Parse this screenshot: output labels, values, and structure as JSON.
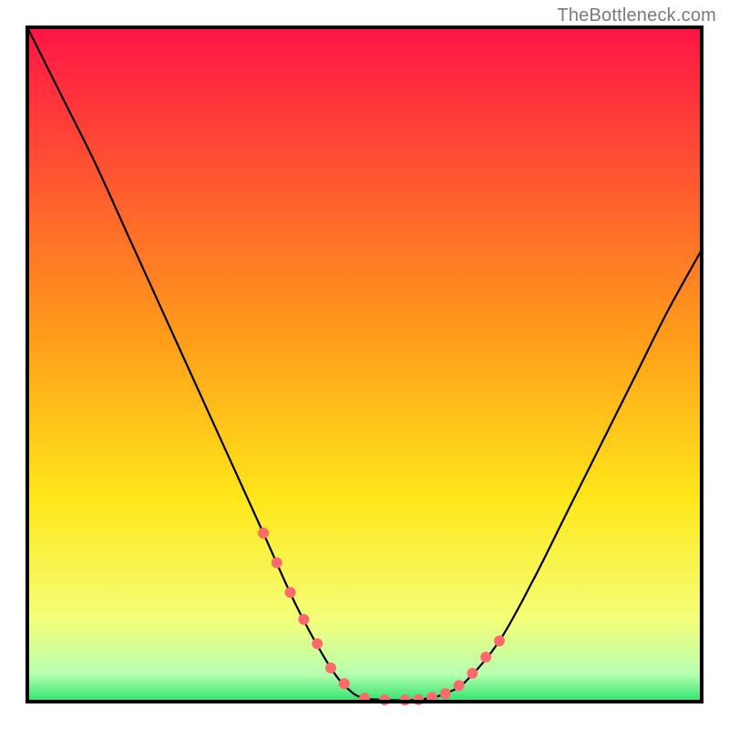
{
  "attribution": "TheBottleneck.com",
  "plot": {
    "x_min": 30,
    "x_max": 770,
    "y_min": 30,
    "y_max": 770
  },
  "gradient_stops": [
    {
      "offset": "0%",
      "color": "#ff1446"
    },
    {
      "offset": "45%",
      "color": "#ff9a1a"
    },
    {
      "offset": "70%",
      "color": "#ffe71a"
    },
    {
      "offset": "88%",
      "color": "#f3ff7a"
    },
    {
      "offset": "96%",
      "color": "#b6ffb0"
    },
    {
      "offset": "100%",
      "color": "#2be36b"
    }
  ],
  "chart_data": {
    "type": "line",
    "title": "",
    "xlabel": "",
    "ylabel": "",
    "xlim": [
      0,
      100
    ],
    "ylim": [
      0,
      100
    ],
    "grid": false,
    "legend": false,
    "x": [
      0,
      5,
      10,
      15,
      20,
      25,
      30,
      35,
      40,
      45,
      48,
      50,
      52,
      55,
      58,
      60,
      62,
      65,
      70,
      75,
      80,
      85,
      90,
      95,
      100
    ],
    "y": [
      100,
      90,
      80,
      69,
      58,
      47,
      36,
      25,
      14,
      5,
      1.5,
      0.5,
      0.3,
      0.2,
      0.3,
      0.6,
      1.2,
      3,
      9,
      18,
      28,
      38,
      48,
      58,
      67
    ],
    "marker_x": [
      35,
      37,
      39,
      41,
      43,
      45,
      47,
      50,
      53,
      56,
      58,
      60,
      62,
      64,
      66,
      68,
      70
    ],
    "marker_r": 6
  }
}
